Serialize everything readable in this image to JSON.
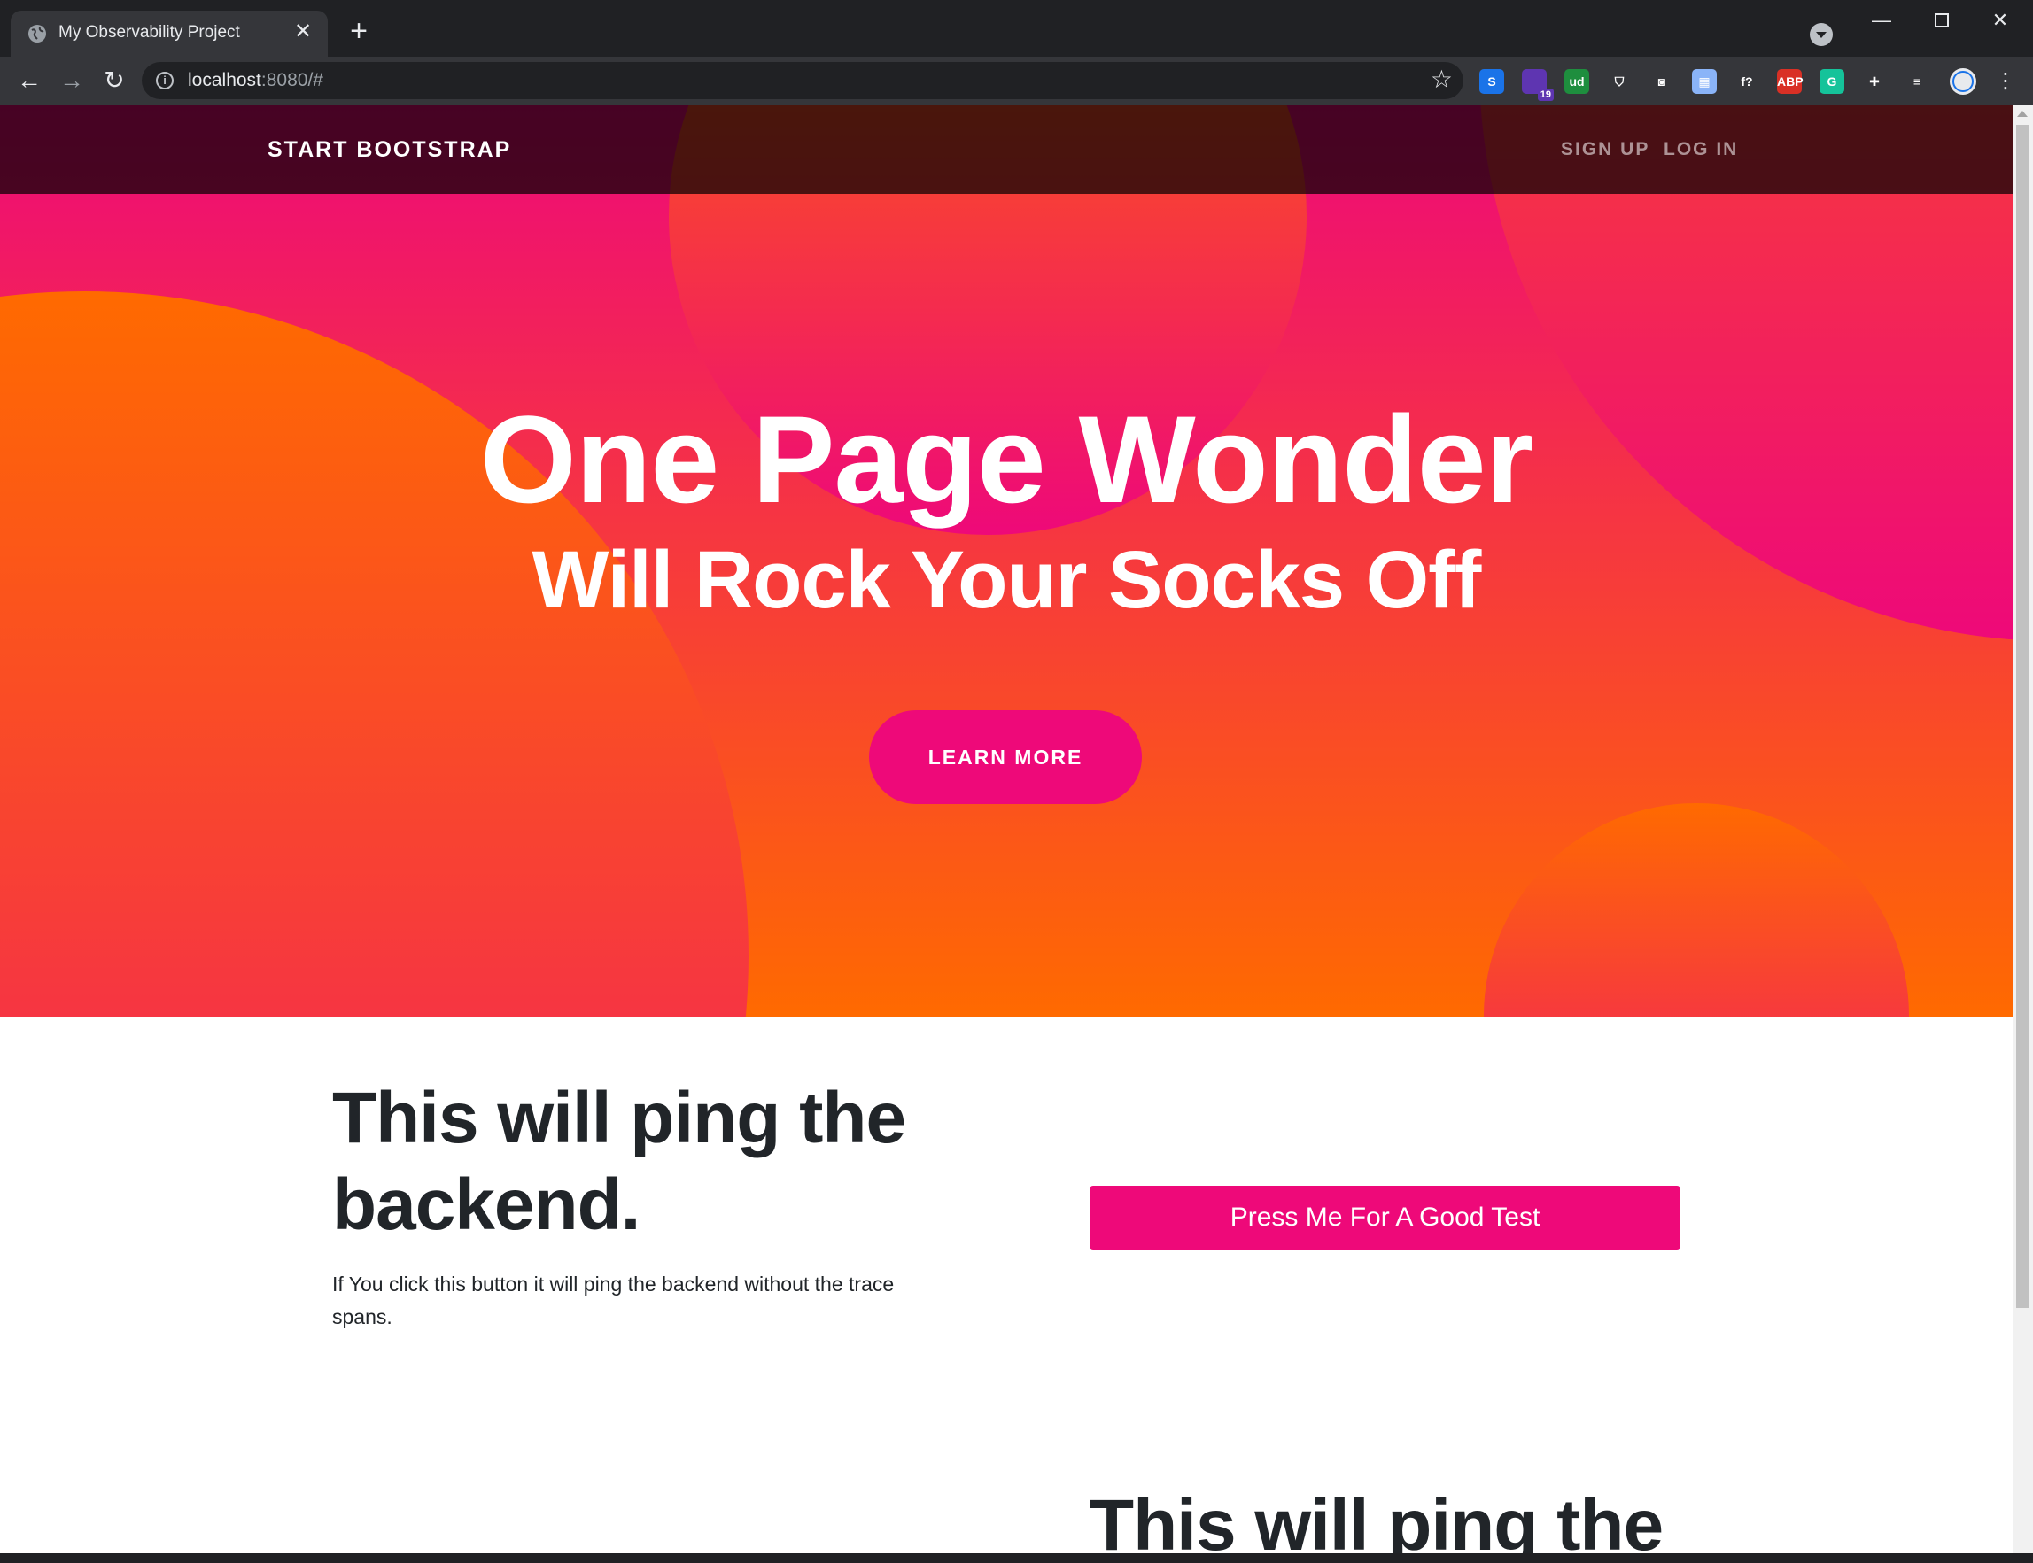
{
  "browser": {
    "tab_title": "My Observability Project",
    "tab_close": "✕",
    "new_tab": "+",
    "url_host": "localhost",
    "url_rest": ":8080/#",
    "extensions": [
      {
        "name": "s-extension-icon",
        "label": "S",
        "color": "#1a73e8"
      },
      {
        "name": "puzzle-badge-icon",
        "label": "",
        "color": "#5e35b1",
        "badge": "19"
      },
      {
        "name": "ud-extension-icon",
        "label": "ud",
        "color": "#1e8e3e"
      },
      {
        "name": "shield-extension-icon",
        "label": "⛉",
        "color": "#35363a"
      },
      {
        "name": "camera-extension-icon",
        "label": "◙",
        "color": "#35363a"
      },
      {
        "name": "image-extension-icon",
        "label": "▦",
        "color": "#8ab4f8"
      },
      {
        "name": "font-extension-icon",
        "label": "f?",
        "color": "#35363a"
      },
      {
        "name": "adblock-icon",
        "label": "ABP",
        "color": "#d93025"
      },
      {
        "name": "grammarly-icon",
        "label": "G",
        "color": "#15c39a"
      },
      {
        "name": "extensions-puzzle-icon",
        "label": "✚",
        "color": "#35363a"
      },
      {
        "name": "reading-list-icon",
        "label": "≡",
        "color": "#35363a"
      }
    ]
  },
  "navbar": {
    "brand": "START BOOTSTRAP",
    "links": [
      "SIGN UP",
      "LOG IN"
    ]
  },
  "masthead": {
    "title": "One Page Wonder",
    "subtitle": "Will Rock Your Socks Off",
    "cta": "LEARN MORE"
  },
  "section1": {
    "heading_line1": "This will ping the",
    "heading_line2": "backend.",
    "text": "If You click this button it will ping the backend without the trace spans.",
    "button": "Press Me For A Good Test"
  },
  "section2": {
    "heading_line1": "This will ping the"
  },
  "colors": {
    "accent": "#ee0979",
    "gradient_end": "#ff6a00",
    "text_dark": "#212529"
  }
}
